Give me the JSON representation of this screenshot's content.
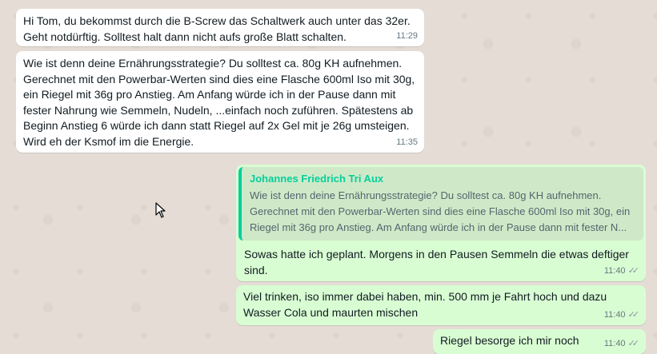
{
  "messages": [
    {
      "direction": "incoming",
      "text": "Hi Tom, du bekommst durch die B-Screw das Schaltwerk auch unter das 32er. Geht notdürftig. Solltest halt dann nicht aufs große Blatt schalten.",
      "time": "11:29"
    },
    {
      "direction": "incoming",
      "text": "Wie ist denn deine Ernährungsstrategie? Du solltest ca. 80g KH aufnehmen. Gerechnet mit den Powerbar-Werten sind dies eine Flasche 600ml Iso mit 30g, ein Riegel mit 36g pro Anstieg. Am Anfang würde ich in der Pause dann mit fester Nahrung wie Semmeln, Nudeln, ...einfach noch zuführen. Spätestens ab Beginn Anstieg 6 würde ich dann statt Riegel auf 2x Gel mit je 26g umsteigen. Wird eh der Ksmof im die Energie.",
      "time": "11:35"
    },
    {
      "direction": "outgoing",
      "quote_author": "Johannes Friedrich Tri Aux",
      "quote_text": "Wie ist denn deine Ernährungsstrategie? Du solltest ca. 80g KH aufnehmen. Gerechnet mit den Powerbar-Werten sind dies eine Flasche 600ml Iso mit 30g, ein Riegel mit 36g pro Anstieg. Am Anfang würde ich in der Pause dann mit fester N...",
      "text": "Sowas hatte ich geplant. Morgens in den Pausen Semmeln die etwas deftiger sind.",
      "time": "11:40",
      "status_icon": "double-check-icon"
    },
    {
      "direction": "outgoing",
      "text": "Viel trinken, iso immer dabei haben, min. 500 mm je Fahrt hoch und dazu Wasser Cola und maurten mischen",
      "time": "11:40",
      "status_icon": "double-check-icon"
    },
    {
      "direction": "outgoing",
      "text": "Riegel besorge ich mir noch",
      "time": "11:40",
      "status_icon": "double-check-icon"
    }
  ],
  "colors": {
    "background": "#e5ddd5",
    "incoming_bubble": "#ffffff",
    "outgoing_bubble": "#d9fdd3",
    "quote_accent": "#06cf9c"
  }
}
